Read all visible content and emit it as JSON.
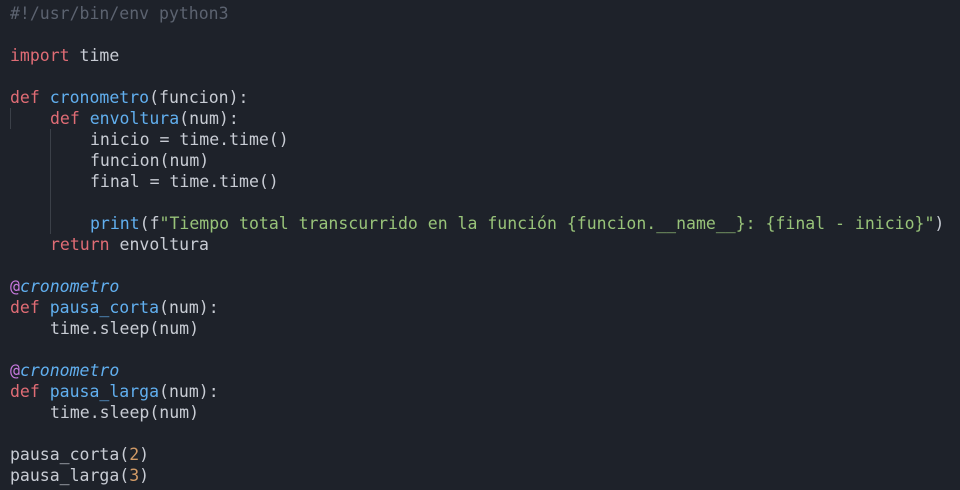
{
  "code": {
    "shebang": "#!/usr/bin/env python3",
    "import_kw": "import",
    "import_mod": " time",
    "def_kw": "def",
    "cronometro_name": "cronometro",
    "cronometro_params": "(funcion):",
    "envoltura_name": "envoltura",
    "num_params": "(num):",
    "inicio_stmt": "inicio = time.time()",
    "funcion_call": "funcion(num)",
    "final_stmt": "final = time.time()",
    "print_fn": "print",
    "print_open": "(f",
    "print_string": "\"Tiempo total transcurrido en la función {funcion.__name__}: {final - inicio}\"",
    "print_close": ")",
    "return_kw": "return",
    "return_val": " envoltura",
    "at_sign": "@",
    "decorator_name": "cronometro",
    "pausa_corta_name": "pausa_corta",
    "pausa_larga_name": "pausa_larga",
    "sleep_stmt": "time.sleep(num)",
    "call_corta": "pausa_corta(",
    "arg_corta": "2",
    "call_larga": "pausa_larga(",
    "arg_larga": "3",
    "close_paren": ")"
  }
}
